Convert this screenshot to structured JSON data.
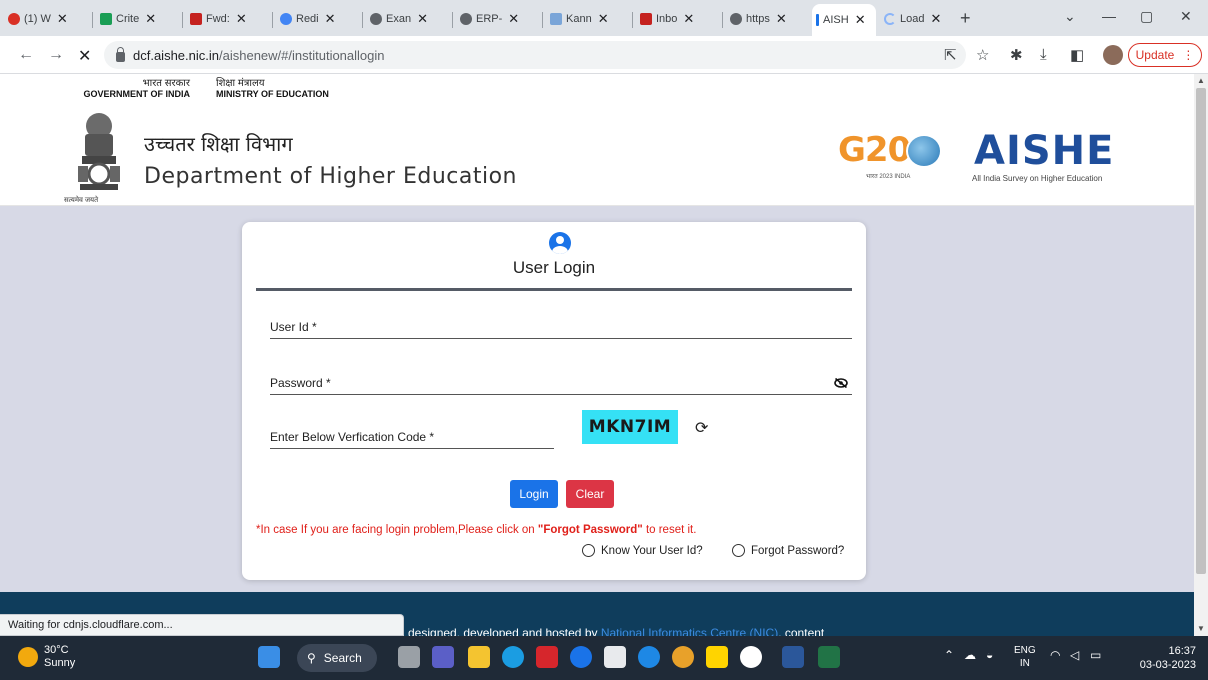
{
  "browser": {
    "tabs": [
      {
        "label": "(1) W",
        "color": "#d93025"
      },
      {
        "label": "Crite",
        "color": "#1a9e55"
      },
      {
        "label": "Fwd:",
        "color": "#c5221f"
      },
      {
        "label": "Redi",
        "color": "#4285f4"
      },
      {
        "label": "Exan",
        "color": "#5f6368"
      },
      {
        "label": "ERP-",
        "color": "#5f6368"
      },
      {
        "label": "Kann",
        "color": "#7aa5d8"
      },
      {
        "label": "Inbo",
        "color": "#c5221f"
      },
      {
        "label": "https",
        "color": "#5f6368"
      },
      {
        "label": "AISH",
        "color": "#1a73e8"
      },
      {
        "label": "Load",
        "color": "#8ab4f8"
      }
    ],
    "url_host": "dcf.aishe.nic.in",
    "url_path": "/aishenew/#/institutionallogin",
    "update_label": "Update",
    "status_text": "Waiting for cdnjs.cloudflare.com..."
  },
  "gov": {
    "gov_hi": "भारत सरकार",
    "gov_en": "GOVERNMENT OF INDIA",
    "ministry_hi": "शिक्षा मंत्रालय",
    "ministry_en": "MINISTRY OF EDUCATION"
  },
  "header": {
    "emblem_caption": "सत्यमेव जयते",
    "dept_hi": "उच्चतर शिक्षा विभाग",
    "dept_en": "Department of Higher Education",
    "g20_text": "G20",
    "g20_sub": "भारत 2023 INDIA",
    "aishe_title": "AISHE",
    "aishe_sub": "All India Survey on Higher Education"
  },
  "login": {
    "title": "User Login",
    "userid_label": "User Id *",
    "password_label": "Password *",
    "verification_label": "Enter Below Verfication Code *",
    "captcha_code": "MKN7IM",
    "login_button": "Login",
    "clear_button": "Clear",
    "help_prefix": "*In case If you are facing login problem,Please click on ",
    "help_bold": "\"Forgot Password\"",
    "help_suffix": " to reset it.",
    "know_userid": "Know Your User Id?",
    "forgot_password": "Forgot Password?"
  },
  "footer": {
    "prefix": "designed, developed and hosted by ",
    "nic": "National Informatics Centre (NIC)",
    "suffix": ", content"
  },
  "taskbar": {
    "temperature": "30°C",
    "weather": "Sunny",
    "search_label": "Search",
    "lang_1": "ENG",
    "lang_2": "IN",
    "time": "16:37",
    "date": "03-03-2023"
  }
}
